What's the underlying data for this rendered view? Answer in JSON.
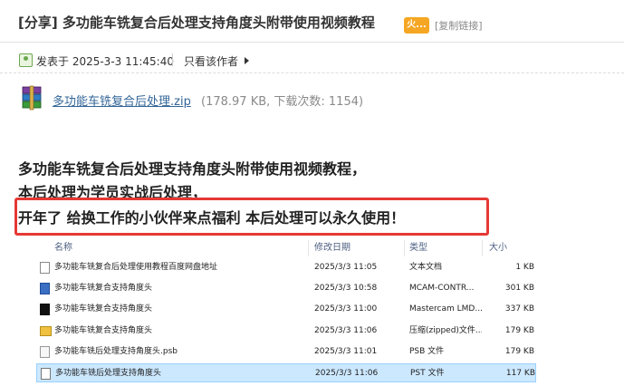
{
  "header": {
    "title": "[分享] 多功能车铣复合后处理支持角度头附带使用视频教程",
    "badge": "火...",
    "copy_link": "[复制链接]"
  },
  "meta": {
    "posted_label": "发表于 2025-3-3 11:45:40",
    "author_only": "只看该作者"
  },
  "attachment": {
    "filename": "多功能车铣复合后处理.zip",
    "info": "(178.97 KB, 下载次数: 1154)"
  },
  "body": {
    "line1": "多功能车铣复合后处理支持角度头附带使用视频教程，",
    "line2": "本后处理为学员实战后处理，",
    "line3": "开年了 给换工作的小伙伴来点福利 本后处理可以永久使用！"
  },
  "explorer": {
    "columns": {
      "name": "名称",
      "modified": "修改日期",
      "type": "类型",
      "size": "大小"
    },
    "files": [
      {
        "name": "多功能车铣复合后处理使用教程百度网盘地址",
        "modified": "2025/3/3 11:05",
        "type": "文本文档",
        "size": "1 KB",
        "icon": "text-file-icon"
      },
      {
        "name": "多功能车铣复合支持角度头",
        "modified": "2025/3/3 10:58",
        "type": "MCAM-CONTR...",
        "size": "301 KB",
        "icon": "mastercam-file-icon"
      },
      {
        "name": "多功能车铣复合支持角度头",
        "modified": "2025/3/3 11:00",
        "type": "Mastercam LMD...",
        "size": "337 KB",
        "icon": "black-file-icon"
      },
      {
        "name": "多功能车铣复合支持角度头",
        "modified": "2025/3/3 11:06",
        "type": "压缩(zipped)文件...",
        "size": "179 KB",
        "icon": "zip-folder-icon"
      },
      {
        "name": "多功能车铣后处理支持角度头.psb",
        "modified": "2025/3/3 11:01",
        "type": "PSB 文件",
        "size": "179 KB",
        "icon": "psb-file-icon"
      },
      {
        "name": "多功能车铣后处理支持角度头",
        "modified": "2025/3/3 11:06",
        "type": "PST 文件",
        "size": "117 KB",
        "icon": "pst-file-icon"
      }
    ],
    "selected_index": 5
  },
  "colors": {
    "highlight": "#e53935",
    "link": "#336699",
    "selection": "#cce8ff"
  }
}
